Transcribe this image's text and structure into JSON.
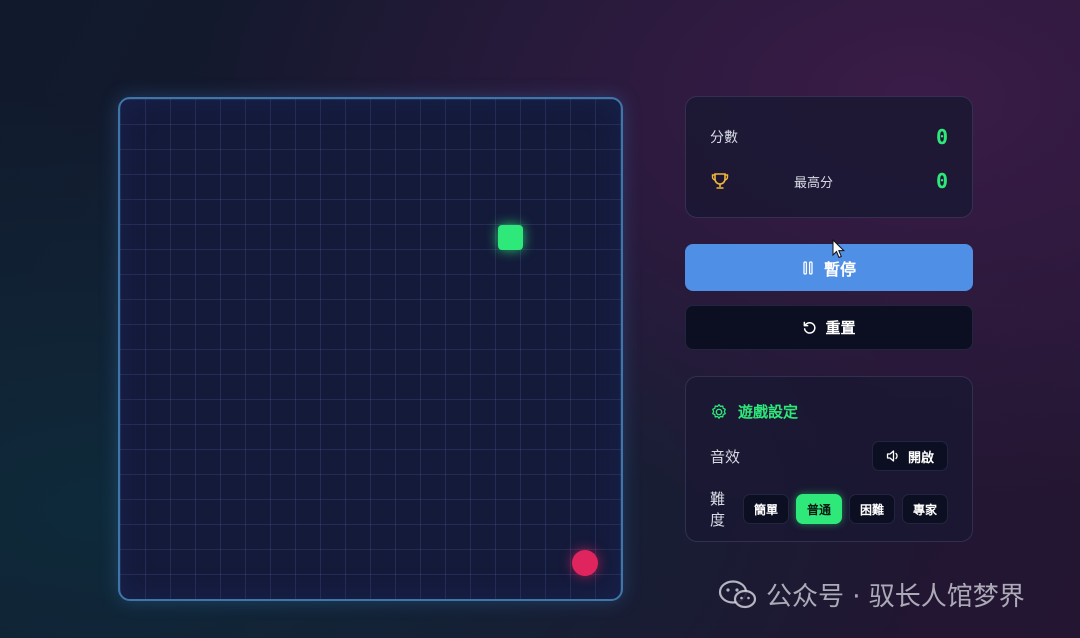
{
  "game": {
    "snake_color": "#2ee87a",
    "food_color": "#e0245e",
    "grid_color": "#3f76a8"
  },
  "score": {
    "score_label": "分數",
    "score_value": "0",
    "high_label": "最高分",
    "high_value": "0"
  },
  "controls": {
    "pause_label": "暫停",
    "reset_label": "重置"
  },
  "settings": {
    "title": "遊戲設定",
    "sound_label": "音效",
    "sound_value": "開啟",
    "difficulty_label": "難度",
    "difficulty_options": [
      "簡單",
      "普通",
      "困難",
      "專家"
    ],
    "difficulty_selected": "普通"
  },
  "watermark": {
    "text": "公众号 · 驭长人馆梦界"
  }
}
